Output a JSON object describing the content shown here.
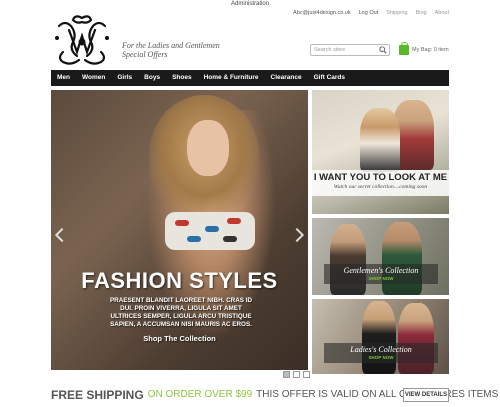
{
  "admin_label": "Administration",
  "top_links": {
    "email": "Abc@just4design.co.uk",
    "logout": "Log Out",
    "shipping": "Shipping",
    "blog": "Blog",
    "about": "About"
  },
  "brand": {
    "tagline_line1": "For the Ladies and Gentlemen",
    "tagline_line2": "Special Offers"
  },
  "search": {
    "placeholder": "Search store"
  },
  "bag": {
    "label": "My Bag: 0 item"
  },
  "nav": {
    "items": [
      {
        "label": "Men"
      },
      {
        "label": "Women"
      },
      {
        "label": "Girls"
      },
      {
        "label": "Boys"
      },
      {
        "label": "Shoes"
      },
      {
        "label": "Home & Furniture"
      },
      {
        "label": "Clearance"
      },
      {
        "label": "Gift Cards"
      }
    ]
  },
  "hero": {
    "title": "FASHION STYLES",
    "text_line1": "Praesent blandit laoreet nibh. Cras id",
    "text_line2": "dui. Proin viverra, ligula sit amet",
    "text_line3": "ultrices semper, ligula arcu tristique",
    "text_line4": "sapien, a accumsan nisi mauris ac eros.",
    "cta": "Shop The Collection"
  },
  "side_panels": {
    "couple": {
      "title": "I WANT YOU TO LOOK AT ME",
      "subtitle": "Watch our secret collection....coming soon"
    },
    "gentlemen": {
      "title": "Gentlemen's Collection",
      "link": "SHOP NOW"
    },
    "ladies": {
      "title": "Ladies's Collection",
      "link": "SHOP NOW"
    }
  },
  "footer": {
    "free_shipping": "FREE SHIPPING",
    "order_text": "ON ORDER OVER $99",
    "valid_text": "THIS OFFER IS VALID ON ALL OUR STORES ITEMS",
    "button": "VIEW DETAILS"
  },
  "colors": {
    "accent_green": "#8cc63f",
    "nav_bg": "#1a1a1a"
  }
}
